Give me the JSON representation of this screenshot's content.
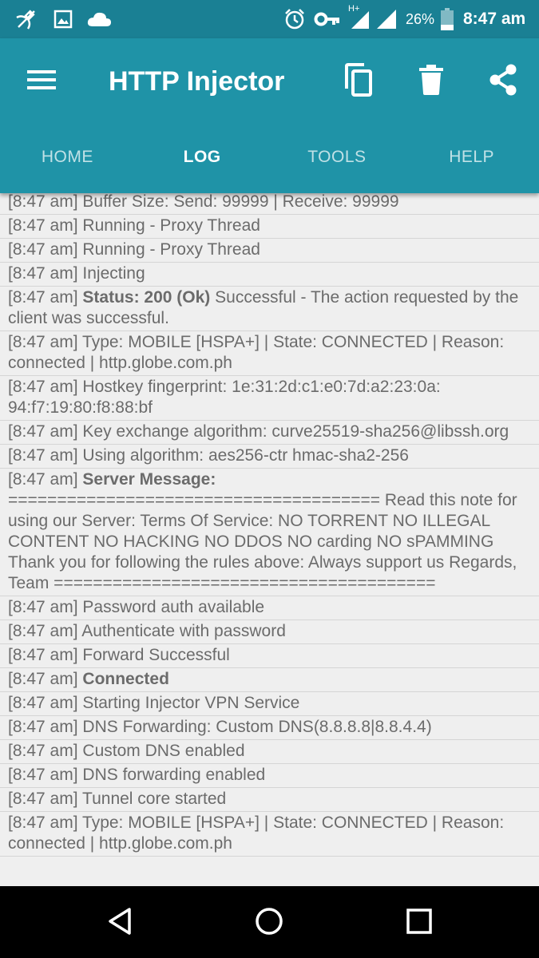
{
  "status_bar": {
    "battery": "26%",
    "time": "8:47 am",
    "network_type": "H+",
    "icons": [
      "satellite-icon",
      "image-icon",
      "cloud-icon",
      "alarm-icon",
      "vpn-key-icon",
      "signal-icon",
      "battery-icon"
    ]
  },
  "app_bar": {
    "title": "HTTP Injector",
    "actions": [
      "copy-icon",
      "delete-icon",
      "share-icon"
    ]
  },
  "tabs": [
    {
      "label": "HOME",
      "active": false
    },
    {
      "label": "LOG",
      "active": true
    },
    {
      "label": "TOOLS",
      "active": false
    },
    {
      "label": "HELP",
      "active": false
    }
  ],
  "log": [
    {
      "time": "[8:47 am]",
      "bold": "",
      "text": "Buffer Size: Send: 99999 | Receive: 99999"
    },
    {
      "time": "[8:47 am]",
      "bold": "",
      "text": "Running - Proxy Thread"
    },
    {
      "time": "[8:47 am]",
      "bold": "",
      "text": "Running - Proxy Thread"
    },
    {
      "time": "[8:47 am]",
      "bold": "",
      "text": "Injecting"
    },
    {
      "time": "[8:47 am]",
      "bold": "Status: 200 (Ok)",
      "text": "Successful - The action requested by the client was successful."
    },
    {
      "time": "[8:47 am]",
      "bold": "",
      "text": "Type: MOBILE [HSPA+] | State: CONNECTED | Reason: connected | http.globe.com.ph"
    },
    {
      "time": "[8:47 am]",
      "bold": "",
      "text": "Hostkey fingerprint: 1e:31:2d:c1:e0:7d:a2:23:0a: 94:f7:19:80:f8:88:bf"
    },
    {
      "time": "[8:47 am]",
      "bold": "",
      "text": "Key exchange algorithm: curve25519-sha256@libssh.org"
    },
    {
      "time": "[8:47 am]",
      "bold": "",
      "text": "Using algorithm: aes256-ctr hmac-sha2-256"
    },
    {
      "time": "[8:47 am]",
      "bold": "Server Message:",
      "text": "====================================== Read this note for using our Server: Terms Of Service: NO TORRENT NO ILLEGAL CONTENT NO HACKING NO DDOS NO carding NO sPAMMING Thank you for following the rules above: Always support us Regards, Team ======================================="
    },
    {
      "time": "[8:47 am]",
      "bold": "",
      "text": "Password auth available"
    },
    {
      "time": "[8:47 am]",
      "bold": "",
      "text": "Authenticate with password"
    },
    {
      "time": "[8:47 am]",
      "bold": "",
      "text": "Forward Successful"
    },
    {
      "time": "[8:47 am]",
      "bold": "Connected",
      "text": ""
    },
    {
      "time": "[8:47 am]",
      "bold": "",
      "text": "Starting Injector VPN Service"
    },
    {
      "time": "[8:47 am]",
      "bold": "",
      "text": "DNS Forwarding: Custom DNS(8.8.8.8|8.8.4.4)"
    },
    {
      "time": "[8:47 am]",
      "bold": "",
      "text": "Custom DNS enabled"
    },
    {
      "time": "[8:47 am]",
      "bold": "",
      "text": "DNS forwarding enabled"
    },
    {
      "time": "[8:47 am]",
      "bold": "",
      "text": "Tunnel core started"
    },
    {
      "time": "[8:47 am]",
      "bold": "",
      "text": "Type: MOBILE [HSPA+] | State: CONNECTED | Reason: connected | http.globe.com.ph"
    }
  ],
  "nav_bar": {
    "buttons": [
      "back-icon",
      "home-icon",
      "recents-icon"
    ]
  }
}
